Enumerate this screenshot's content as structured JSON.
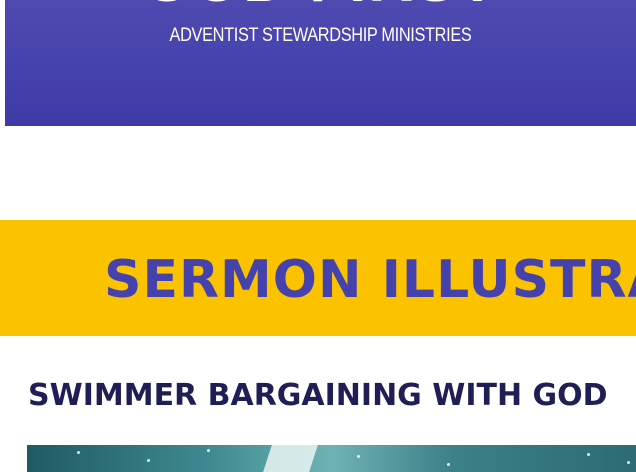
{
  "header": {
    "logo_text": "GOD FIRST",
    "subtitle": "ADVENTIST STEWARDSHIP MINISTRIES",
    "background_color": "#4642ad"
  },
  "banner": {
    "title": "SERMON ILLUSTRATIONS",
    "background_color": "#fbc200",
    "text_color": "#4642ad"
  },
  "post": {
    "title": "SWIMMER BARGAINING WITH GOD",
    "image_alt": "swimmer-in-water-photo"
  }
}
